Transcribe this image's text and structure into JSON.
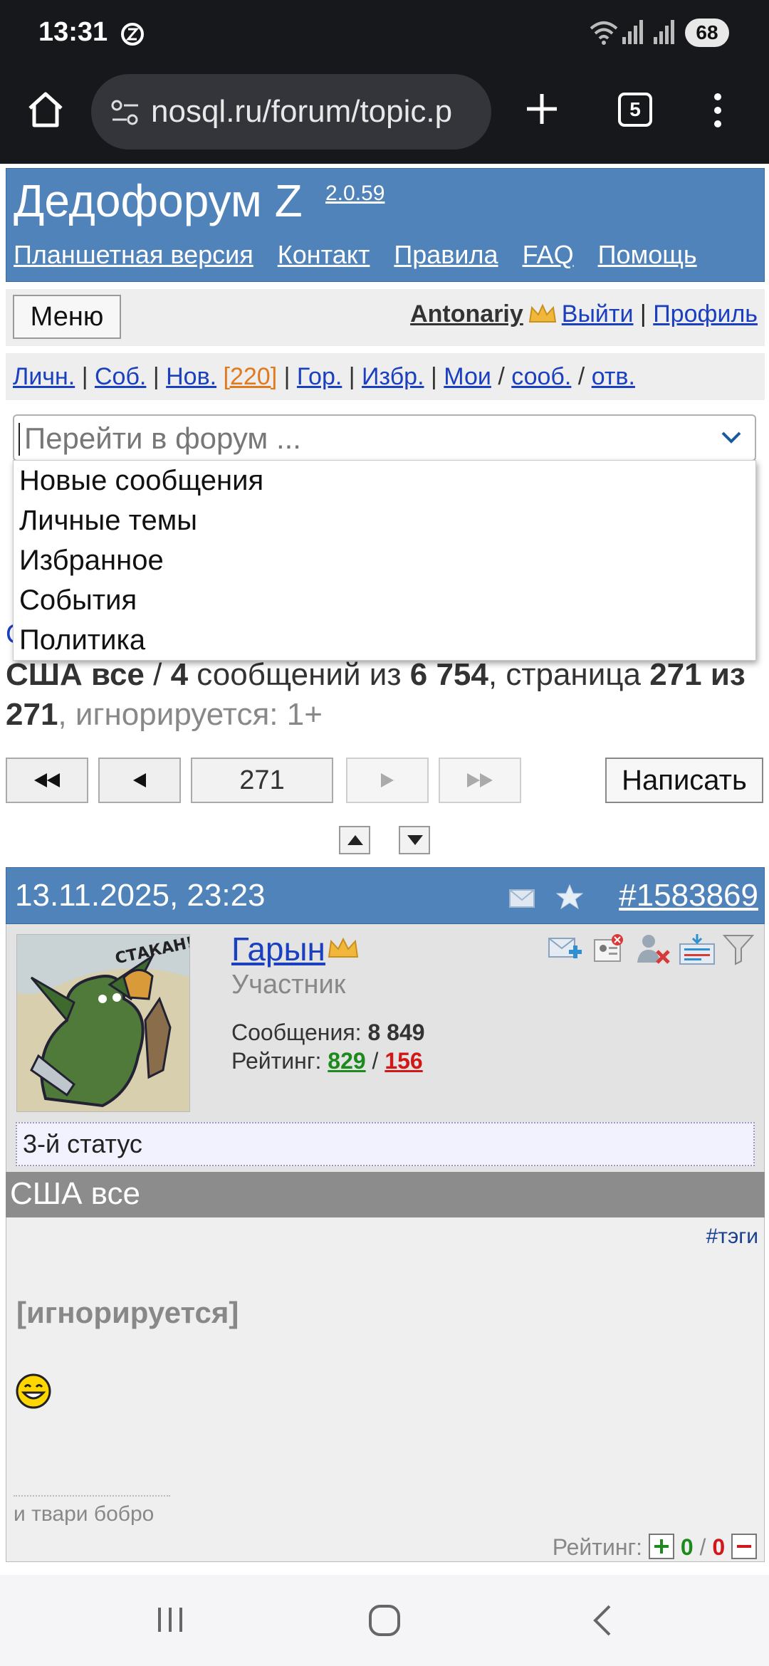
{
  "status_bar": {
    "time": "13:31",
    "battery": "68",
    "icons": [
      "alarm-icon",
      "wifi-icon",
      "signal-icon",
      "signal-icon-2"
    ]
  },
  "browser": {
    "url": "nosql.ru/forum/topic.p",
    "tab_count": "5"
  },
  "forum": {
    "title": "Дедофорум Z",
    "version": "2.0.59",
    "nav": [
      "Планшетная версия",
      "Контакт",
      "Правила",
      "FAQ",
      "Помощь"
    ],
    "menu_label": "Меню",
    "username": "Antonariy",
    "logout": "Выйти",
    "separator": "|",
    "profile": "Профиль",
    "links": {
      "personal": "Личн.",
      "events": "Соб.",
      "new": "Нов.",
      "new_count": "[220]",
      "hot": "Гор.",
      "favorites": "Избр.",
      "mine": "Мои",
      "msgs": "сооб.",
      "replies": "отв."
    },
    "forum_select_placeholder": "Перейти в форум ...",
    "dropdown_options": [
      "Новые сообщения",
      "Личные темы",
      "Избранное",
      "События",
      "Политика"
    ],
    "hidden_link": "С"
  },
  "topic": {
    "name": "США все",
    "sep": " / ",
    "count": "4",
    "of_msgs": " сообщений из ",
    "total": "6 754",
    "page_word": ", страница ",
    "page": "271",
    "of_word": " из ",
    "pages": "271",
    "ignored_info": ", игнорируется: 1+"
  },
  "pager": {
    "current_page": "271",
    "write_label": "Написать"
  },
  "post": {
    "date": "13.11.2025, 23:23",
    "id": "#1583869",
    "author": "Гарын",
    "role": "Участник",
    "messages_label": "Сообщения: ",
    "messages": "8 849",
    "rating_label": "Рейтинг: ",
    "rating_plus": "829",
    "rating_sep": " / ",
    "rating_minus": "156",
    "status": "3-й статус",
    "avatar_text": "СТАКАН!",
    "subject": "США все",
    "tags": "#тэги",
    "body": "[игнорируется]",
    "signature": "и твари бобро",
    "vote_label": "Рейтинг: ",
    "vote_plus": "0",
    "vote_minus": "0"
  },
  "colors": {
    "header_blue": "#4f83ba",
    "link_blue": "#1a3fbf",
    "orange": "#e07a1f",
    "green": "#1d8a1d",
    "red": "#d01818"
  }
}
